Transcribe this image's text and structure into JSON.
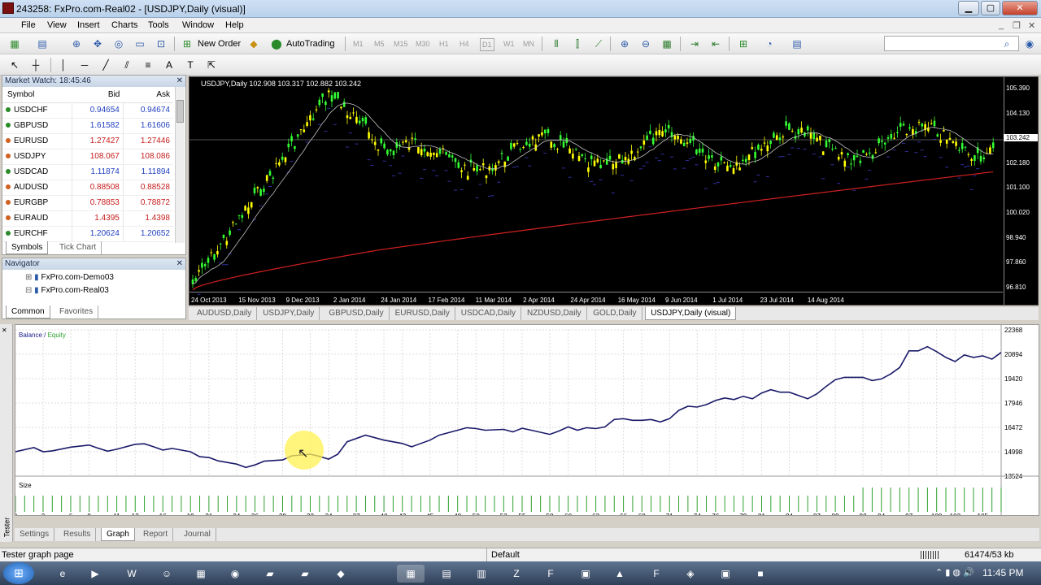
{
  "window": {
    "title": "243258: FxPro.com-Real02 - [USDJPY,Daily (visual)]"
  },
  "menu": [
    "File",
    "View",
    "Insert",
    "Charts",
    "Tools",
    "Window",
    "Help"
  ],
  "toolbar": {
    "new_order": "New Order",
    "autotrading": "AutoTrading",
    "timeframes": [
      "M1",
      "M5",
      "M15",
      "M30",
      "H1",
      "H4",
      "D1",
      "W1",
      "MN"
    ]
  },
  "market_watch": {
    "title": "Market Watch: 18:45:46",
    "col_symbol": "Symbol",
    "col_bid": "Bid",
    "col_ask": "Ask",
    "rows": [
      {
        "symbol": "USDCHF",
        "bid": "0.94654",
        "ask": "0.94674",
        "dir": "up"
      },
      {
        "symbol": "GBPUSD",
        "bid": "1.61582",
        "ask": "1.61606",
        "dir": "up"
      },
      {
        "symbol": "EURUSD",
        "bid": "1.27427",
        "ask": "1.27446",
        "dir": "dn"
      },
      {
        "symbol": "USDJPY",
        "bid": "108.067",
        "ask": "108.086",
        "dir": "dn"
      },
      {
        "symbol": "USDCAD",
        "bid": "1.11874",
        "ask": "1.11894",
        "dir": "up"
      },
      {
        "symbol": "AUDUSD",
        "bid": "0.88508",
        "ask": "0.88528",
        "dir": "dn"
      },
      {
        "symbol": "EURGBP",
        "bid": "0.78853",
        "ask": "0.78872",
        "dir": "dn"
      },
      {
        "symbol": "EURAUD",
        "bid": "1.4395",
        "ask": "1.4398",
        "dir": "dn"
      },
      {
        "symbol": "EURCHF",
        "bid": "1.20624",
        "ask": "1.20652",
        "dir": "up"
      }
    ],
    "tabs": [
      "Symbols",
      "Tick Chart"
    ]
  },
  "navigator": {
    "title": "Navigator",
    "items": [
      "FxPro.com-Demo03",
      "FxPro.com-Real03"
    ],
    "tabs": [
      "Common",
      "Favorites"
    ]
  },
  "chart": {
    "header": "USDJPY,Daily  102.908 103.317 102.882 103.242",
    "yticks": [
      "105.390",
      "104.130",
      "103.242",
      "102.180",
      "101.100",
      "100.020",
      "98.940",
      "97.860",
      "96.810"
    ],
    "xticks": [
      "24 Oct 2013",
      "15 Nov 2013",
      "9 Dec 2013",
      "2 Jan 2014",
      "24 Jan 2014",
      "17 Feb 2014",
      "11 Mar 2014",
      "2 Apr 2014",
      "24 Apr 2014",
      "16 May 2014",
      "9 Jun 2014",
      "1 Jul 2014",
      "23 Jul 2014",
      "14 Aug 2014"
    ],
    "tabs": [
      "AUDUSD,Daily",
      "USDJPY,Daily",
      "GBPUSD,Daily",
      "EURUSD,Daily",
      "USDCAD,Daily",
      "NZDUSD,Daily",
      "GOLD,Daily",
      "USDJPY,Daily (visual)"
    ],
    "colors": {
      "bull": "#33ff33",
      "bear": "#ffff00",
      "ma_fast": "#c0c0c0",
      "ma_slow": "#d02020"
    }
  },
  "tester": {
    "legend_balance": "Balance",
    "legend_sep": " / ",
    "legend_equity": "Equity",
    "size_label": "Size",
    "side_label": "Tester",
    "tabs": [
      "Settings",
      "Results",
      "Graph",
      "Report",
      "Journal"
    ]
  },
  "chart_data": {
    "type": "line",
    "yticks": [
      22368,
      20894,
      19420,
      17946,
      16472,
      14998,
      13524
    ],
    "ylim": [
      13524,
      22368
    ],
    "xticks": [
      0,
      3,
      6,
      8,
      11,
      13,
      16,
      19,
      21,
      24,
      26,
      29,
      32,
      34,
      37,
      40,
      42,
      45,
      48,
      50,
      53,
      55,
      58,
      60,
      63,
      66,
      68,
      71,
      74,
      76,
      79,
      81,
      84,
      87,
      89,
      92,
      94,
      97,
      100,
      102,
      105
    ],
    "series": [
      {
        "name": "Balance",
        "x": [
          0,
          2,
          3,
          4,
          6,
          8,
          9,
          10,
          11,
          13,
          14,
          15,
          16,
          17,
          19,
          20,
          21,
          22,
          24,
          25,
          26,
          27,
          29,
          30,
          32,
          33,
          34,
          35,
          36,
          38,
          40,
          42,
          43,
          45,
          46,
          48,
          49,
          50,
          51,
          53,
          54,
          55,
          56,
          58,
          59,
          60,
          61,
          62,
          63,
          64,
          65,
          66,
          67,
          68,
          69,
          70,
          71,
          72,
          73,
          74,
          75,
          76,
          77,
          78,
          79,
          80,
          81,
          82,
          83,
          84,
          85,
          86,
          87,
          88,
          89,
          90,
          91,
          92,
          93,
          94,
          95,
          96,
          97,
          98,
          99,
          100,
          101,
          102,
          103,
          104,
          105,
          106,
          107
        ],
        "values": [
          14998,
          15250,
          15000,
          15050,
          15280,
          15400,
          15210,
          15030,
          15150,
          15450,
          15480,
          15300,
          15100,
          15200,
          15000,
          14700,
          14650,
          14450,
          14250,
          14050,
          14200,
          14430,
          14500,
          14750,
          14850,
          14720,
          14550,
          14850,
          15600,
          16000,
          15700,
          15500,
          15300,
          15700,
          16000,
          16300,
          16450,
          16400,
          16300,
          16350,
          16200,
          16420,
          16300,
          16050,
          16250,
          16500,
          16300,
          16450,
          16400,
          16500,
          16950,
          17000,
          16900,
          16900,
          16950,
          16800,
          17000,
          17500,
          17750,
          17700,
          17850,
          18100,
          18250,
          18150,
          18350,
          18200,
          18550,
          18750,
          18600,
          18600,
          18400,
          18200,
          18500,
          18950,
          19350,
          19500,
          19500,
          19500,
          19300,
          19400,
          19700,
          20100,
          21100,
          21100,
          21350,
          21050,
          20700,
          20450,
          20850,
          20700,
          20800,
          20600,
          21000
        ]
      },
      {
        "name": "Equity",
        "x": [],
        "values": []
      }
    ]
  }
}
